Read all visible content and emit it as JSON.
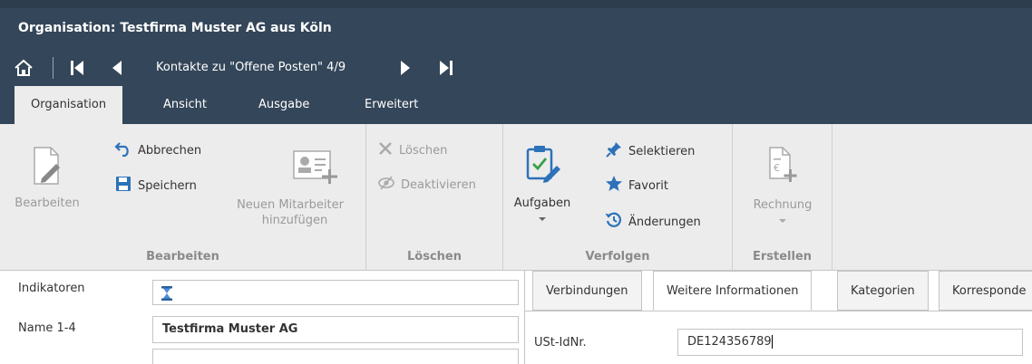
{
  "window": {
    "title": "Organisation: Testfirma Muster AG aus Köln"
  },
  "nav": {
    "label": "Kontakte zu \"Offene Posten\" 4/9",
    "icons": [
      "home-icon",
      "first-record-icon",
      "previous-record-icon",
      "next-record-icon",
      "last-record-icon"
    ]
  },
  "ribbon_tabs": [
    {
      "label": "Organisation",
      "active": true
    },
    {
      "label": "Ansicht"
    },
    {
      "label": "Ausgabe"
    },
    {
      "label": "Erweitert"
    }
  ],
  "ribbon": {
    "bearbeiten": {
      "label": "Bearbeiten",
      "edit": "Bearbeiten",
      "cancel": "Abbrechen",
      "save": "Speichern",
      "add_employee_1": "Neuen Mitarbeiter",
      "add_employee_2": "hinzufügen"
    },
    "loeschen": {
      "label": "Löschen",
      "delete": "Löschen",
      "deactivate": "Deaktivieren"
    },
    "verfolgen": {
      "label": "Verfolgen",
      "tasks": "Aufgaben",
      "select": "Selektieren",
      "favorite": "Favorit",
      "changes": "Änderungen"
    },
    "erstellen": {
      "label": "Erstellen",
      "invoice": "Rechnung"
    }
  },
  "form": {
    "indicators_label": "Indikatoren",
    "name_label": "Name 1-4",
    "name_value": "Testfirma Muster AG"
  },
  "detail_tabs": [
    {
      "label": "Verbindungen"
    },
    {
      "label": "Weitere Informationen",
      "active": true
    },
    {
      "label": "Kategorien"
    },
    {
      "label": "Korresponde"
    }
  ],
  "detail": {
    "vat_label": "USt-IdNr.",
    "vat_value": "DE124356789"
  },
  "colors": {
    "header": "#344659",
    "ribbon": "#ececec",
    "accent": "#2d72b8",
    "disabled": "#9a9a9a"
  }
}
